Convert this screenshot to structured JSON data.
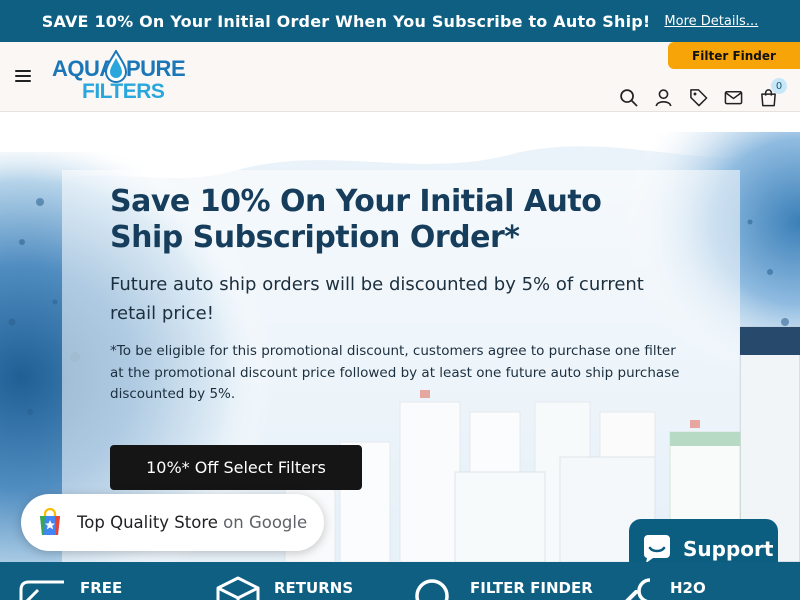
{
  "promo": {
    "text": "SAVE 10% On Your Initial Order When You Subscribe to Auto Ship!",
    "link": "More Details..."
  },
  "header": {
    "logo": {
      "line1_left": "AQUA",
      "line1_right": "PURE",
      "line2": "FILTERS"
    },
    "filter_finder_label": "Filter Finder",
    "cart_count": "0",
    "icons": [
      "menu-icon",
      "search-icon",
      "account-icon",
      "tag-icon",
      "mail-icon",
      "cart-icon"
    ]
  },
  "hero": {
    "title": "Save 10% On Your Initial Auto Ship Subscription Order*",
    "subtitle": "Future auto ship orders will be discounted by 5% of current retail price!",
    "fine_print": "*To be eligible for this promotional discount, customers agree to purchase one filter at the promotional discount price followed by at least one future auto ship purchase discounted by 5%.",
    "cta_label": "10%* Off Select Filters"
  },
  "google_badge": {
    "text_main": "Top Quality Store",
    "text_secondary": "on Google"
  },
  "support": {
    "label": "Support"
  },
  "features": [
    {
      "label": "FREE",
      "icon": "truck-icon"
    },
    {
      "label": "RETURNS",
      "icon": "box-icon"
    },
    {
      "label": "FILTER FINDER",
      "icon": "magnifier-icon"
    },
    {
      "label": "H2O",
      "icon": "wrench-icon"
    }
  ],
  "colors": {
    "brand_blue": "#0e5f82",
    "title_navy": "#163e5c",
    "accent_orange": "#f7a409",
    "logo_blue": "#1c77b8",
    "logo_light_blue": "#29a7dc"
  }
}
